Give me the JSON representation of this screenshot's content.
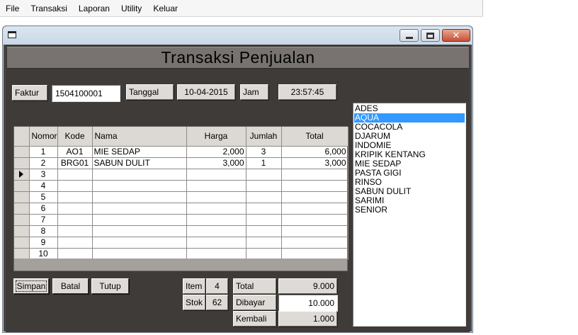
{
  "menu": [
    "File",
    "Transaksi",
    "Laporan",
    "Utility",
    "Keluar"
  ],
  "window": {
    "title": "Transaksi Penjualan"
  },
  "header": {
    "faktur_label": "Faktur",
    "faktur_value": "1504100001",
    "tanggal_label": "Tanggal",
    "tanggal_value": "10-04-2015",
    "jam_label": "Jam",
    "jam_value": "23:57:45"
  },
  "grid": {
    "columns": [
      "Nomor",
      "Kode",
      "Nama",
      "Harga",
      "Jumlah",
      "Total"
    ],
    "rows": [
      {
        "no": "1",
        "kode": "AO1",
        "nama": "MIE SEDAP",
        "harga": "2,000",
        "jumlah": "3",
        "total": "6,000"
      },
      {
        "no": "2",
        "kode": "BRG01",
        "nama": "SABUN DULIT",
        "harga": "3,000",
        "jumlah": "1",
        "total": "3,000"
      },
      {
        "no": "3",
        "kode": "",
        "nama": "",
        "harga": "",
        "jumlah": "",
        "total": ""
      },
      {
        "no": "4",
        "kode": "",
        "nama": "",
        "harga": "",
        "jumlah": "",
        "total": ""
      },
      {
        "no": "5",
        "kode": "",
        "nama": "",
        "harga": "",
        "jumlah": "",
        "total": ""
      },
      {
        "no": "6",
        "kode": "",
        "nama": "",
        "harga": "",
        "jumlah": "",
        "total": ""
      },
      {
        "no": "7",
        "kode": "",
        "nama": "",
        "harga": "",
        "jumlah": "",
        "total": ""
      },
      {
        "no": "8",
        "kode": "",
        "nama": "",
        "harga": "",
        "jumlah": "",
        "total": ""
      },
      {
        "no": "9",
        "kode": "",
        "nama": "",
        "harga": "",
        "jumlah": "",
        "total": ""
      },
      {
        "no": "10",
        "kode": "",
        "nama": "",
        "harga": "",
        "jumlah": "",
        "total": ""
      }
    ],
    "current_row": 3
  },
  "list": {
    "items": [
      "ADES",
      "AQUA",
      "COCACOLA",
      "DJARUM",
      "INDOMIE",
      "KRIPIK KENTANG",
      "MIE SEDAP",
      "PASTA GIGI",
      "RINSO",
      "SABUN DULIT",
      "SARIMI",
      "SENIOR"
    ],
    "selected": "AQUA"
  },
  "buttons": {
    "simpan": "Simpan",
    "batal": "Batal",
    "tutup": "Tutup"
  },
  "summary": {
    "item_label": "Item",
    "item_value": "4",
    "stok_label": "Stok",
    "stok_value": "62",
    "total_label": "Total",
    "total_value": "9.000",
    "dibayar_label": "Dibayar",
    "dibayar_value": "10.000",
    "kembali_label": "Kembali",
    "kembali_value": "1.000"
  },
  "colors": {
    "form_bg": "#3f3b38",
    "header_bg": "#787370",
    "selection": "#3399ff"
  }
}
